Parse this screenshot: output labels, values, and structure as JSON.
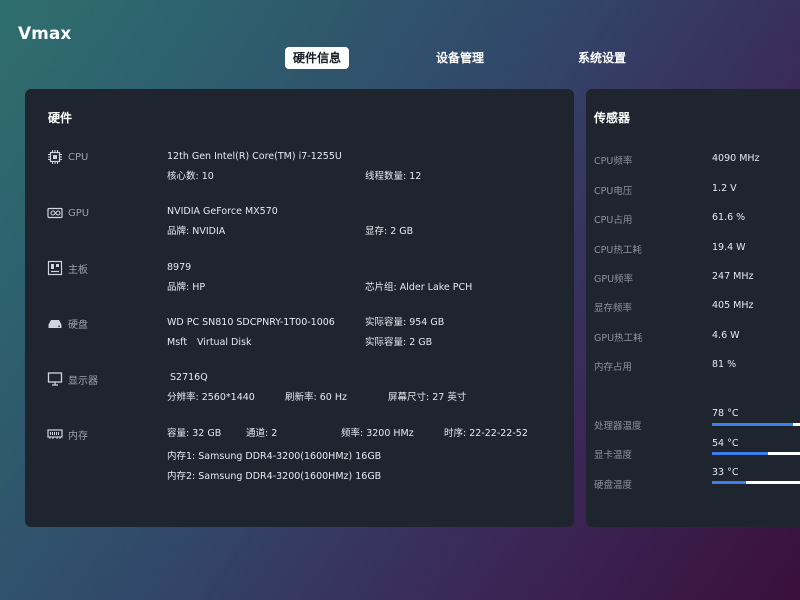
{
  "app": {
    "title": "Vmax"
  },
  "tabs": [
    {
      "label": "硬件信息",
      "active": true
    },
    {
      "label": "设备管理",
      "active": false
    },
    {
      "label": "系统设置",
      "active": false
    }
  ],
  "hardware": {
    "title": "硬件",
    "cpu": {
      "label": "CPU",
      "icon": "cpu-icon",
      "name": "12th Gen Intel(R) Core(TM) i7-1255U",
      "cores": "核心数: 10",
      "threads": "线程数量: 12"
    },
    "gpu": {
      "label": "GPU",
      "icon": "gpu-icon",
      "name": "NVIDIA GeForce MX570",
      "brand": "品牌: NVIDIA",
      "vram": "显存: 2 GB"
    },
    "motherboard": {
      "label": "主板",
      "icon": "motherboard-icon",
      "name": "8979",
      "brand": "品牌: HP",
      "chipset": "芯片组: Alder Lake PCH"
    },
    "disk": {
      "label": "硬盘",
      "icon": "disk-icon",
      "disk1_name": "WD PC SN810 SDCPNRY-1T00-1006",
      "disk1_capacity": "实际容量: 954 GB",
      "disk2_vendor": "Msft",
      "disk2_name": "Virtual Disk",
      "disk2_capacity": "实际容量: 2 GB"
    },
    "display": {
      "label": "显示器",
      "icon": "monitor-icon",
      "name": "S2716Q",
      "resolution": "分辨率: 2560*1440",
      "refresh": "刷新率: 60 Hz",
      "size": "屏幕尺寸: 27 英寸"
    },
    "memory": {
      "label": "内存",
      "icon": "memory-icon",
      "capacity": "容量: 32 GB",
      "channels": "通道: 2",
      "frequency": "频率: 3200 HMz",
      "timing": "时序: 22-22-22-52",
      "stick1": "内存1: Samsung DDR4-3200(1600HMz) 16GB",
      "stick2": "内存2: Samsung DDR4-3200(1600HMz) 16GB"
    }
  },
  "sensors": {
    "title": "传感器",
    "items": [
      {
        "label": "CPU频率",
        "value": "4090 MHz"
      },
      {
        "label": "CPU电压",
        "value": "1.2 V"
      },
      {
        "label": "CPU占用",
        "value": "61.6 %"
      },
      {
        "label": "CPU热工耗",
        "value": "19.4 W"
      },
      {
        "label": "GPU频率",
        "value": "247 MHz"
      },
      {
        "label": "显存频率",
        "value": "405 MHz"
      },
      {
        "label": "GPU热工耗",
        "value": "4.6 W"
      },
      {
        "label": "内存占用",
        "value": "81 %"
      }
    ],
    "temps": [
      {
        "label": "处理器温度",
        "value": "78 °C",
        "level": 0.78
      },
      {
        "label": "显卡温度",
        "value": "54 °C",
        "level": 0.54
      },
      {
        "label": "硬盘温度",
        "value": "33 °C",
        "level": 0.33
      }
    ]
  },
  "colors": {
    "accent": "#3d7fe8",
    "panel": "#1f252f"
  }
}
